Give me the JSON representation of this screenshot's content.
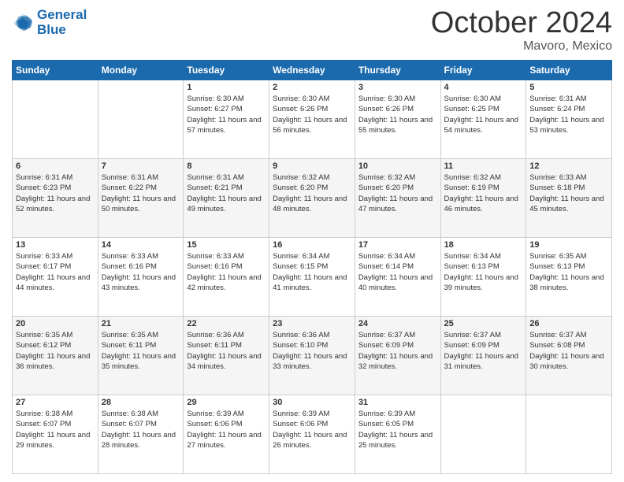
{
  "header": {
    "logo_line1": "General",
    "logo_line2": "Blue",
    "month": "October 2024",
    "location": "Mavoro, Mexico"
  },
  "weekdays": [
    "Sunday",
    "Monday",
    "Tuesday",
    "Wednesday",
    "Thursday",
    "Friday",
    "Saturday"
  ],
  "weeks": [
    [
      {
        "day": "",
        "info": ""
      },
      {
        "day": "",
        "info": ""
      },
      {
        "day": "1",
        "info": "Sunrise: 6:30 AM\nSunset: 6:27 PM\nDaylight: 11 hours and 57 minutes."
      },
      {
        "day": "2",
        "info": "Sunrise: 6:30 AM\nSunset: 6:26 PM\nDaylight: 11 hours and 56 minutes."
      },
      {
        "day": "3",
        "info": "Sunrise: 6:30 AM\nSunset: 6:26 PM\nDaylight: 11 hours and 55 minutes."
      },
      {
        "day": "4",
        "info": "Sunrise: 6:30 AM\nSunset: 6:25 PM\nDaylight: 11 hours and 54 minutes."
      },
      {
        "day": "5",
        "info": "Sunrise: 6:31 AM\nSunset: 6:24 PM\nDaylight: 11 hours and 53 minutes."
      }
    ],
    [
      {
        "day": "6",
        "info": "Sunrise: 6:31 AM\nSunset: 6:23 PM\nDaylight: 11 hours and 52 minutes."
      },
      {
        "day": "7",
        "info": "Sunrise: 6:31 AM\nSunset: 6:22 PM\nDaylight: 11 hours and 50 minutes."
      },
      {
        "day": "8",
        "info": "Sunrise: 6:31 AM\nSunset: 6:21 PM\nDaylight: 11 hours and 49 minutes."
      },
      {
        "day": "9",
        "info": "Sunrise: 6:32 AM\nSunset: 6:20 PM\nDaylight: 11 hours and 48 minutes."
      },
      {
        "day": "10",
        "info": "Sunrise: 6:32 AM\nSunset: 6:20 PM\nDaylight: 11 hours and 47 minutes."
      },
      {
        "day": "11",
        "info": "Sunrise: 6:32 AM\nSunset: 6:19 PM\nDaylight: 11 hours and 46 minutes."
      },
      {
        "day": "12",
        "info": "Sunrise: 6:33 AM\nSunset: 6:18 PM\nDaylight: 11 hours and 45 minutes."
      }
    ],
    [
      {
        "day": "13",
        "info": "Sunrise: 6:33 AM\nSunset: 6:17 PM\nDaylight: 11 hours and 44 minutes."
      },
      {
        "day": "14",
        "info": "Sunrise: 6:33 AM\nSunset: 6:16 PM\nDaylight: 11 hours and 43 minutes."
      },
      {
        "day": "15",
        "info": "Sunrise: 6:33 AM\nSunset: 6:16 PM\nDaylight: 11 hours and 42 minutes."
      },
      {
        "day": "16",
        "info": "Sunrise: 6:34 AM\nSunset: 6:15 PM\nDaylight: 11 hours and 41 minutes."
      },
      {
        "day": "17",
        "info": "Sunrise: 6:34 AM\nSunset: 6:14 PM\nDaylight: 11 hours and 40 minutes."
      },
      {
        "day": "18",
        "info": "Sunrise: 6:34 AM\nSunset: 6:13 PM\nDaylight: 11 hours and 39 minutes."
      },
      {
        "day": "19",
        "info": "Sunrise: 6:35 AM\nSunset: 6:13 PM\nDaylight: 11 hours and 38 minutes."
      }
    ],
    [
      {
        "day": "20",
        "info": "Sunrise: 6:35 AM\nSunset: 6:12 PM\nDaylight: 11 hours and 36 minutes."
      },
      {
        "day": "21",
        "info": "Sunrise: 6:35 AM\nSunset: 6:11 PM\nDaylight: 11 hours and 35 minutes."
      },
      {
        "day": "22",
        "info": "Sunrise: 6:36 AM\nSunset: 6:11 PM\nDaylight: 11 hours and 34 minutes."
      },
      {
        "day": "23",
        "info": "Sunrise: 6:36 AM\nSunset: 6:10 PM\nDaylight: 11 hours and 33 minutes."
      },
      {
        "day": "24",
        "info": "Sunrise: 6:37 AM\nSunset: 6:09 PM\nDaylight: 11 hours and 32 minutes."
      },
      {
        "day": "25",
        "info": "Sunrise: 6:37 AM\nSunset: 6:09 PM\nDaylight: 11 hours and 31 minutes."
      },
      {
        "day": "26",
        "info": "Sunrise: 6:37 AM\nSunset: 6:08 PM\nDaylight: 11 hours and 30 minutes."
      }
    ],
    [
      {
        "day": "27",
        "info": "Sunrise: 6:38 AM\nSunset: 6:07 PM\nDaylight: 11 hours and 29 minutes."
      },
      {
        "day": "28",
        "info": "Sunrise: 6:38 AM\nSunset: 6:07 PM\nDaylight: 11 hours and 28 minutes."
      },
      {
        "day": "29",
        "info": "Sunrise: 6:39 AM\nSunset: 6:06 PM\nDaylight: 11 hours and 27 minutes."
      },
      {
        "day": "30",
        "info": "Sunrise: 6:39 AM\nSunset: 6:06 PM\nDaylight: 11 hours and 26 minutes."
      },
      {
        "day": "31",
        "info": "Sunrise: 6:39 AM\nSunset: 6:05 PM\nDaylight: 11 hours and 25 minutes."
      },
      {
        "day": "",
        "info": ""
      },
      {
        "day": "",
        "info": ""
      }
    ]
  ]
}
